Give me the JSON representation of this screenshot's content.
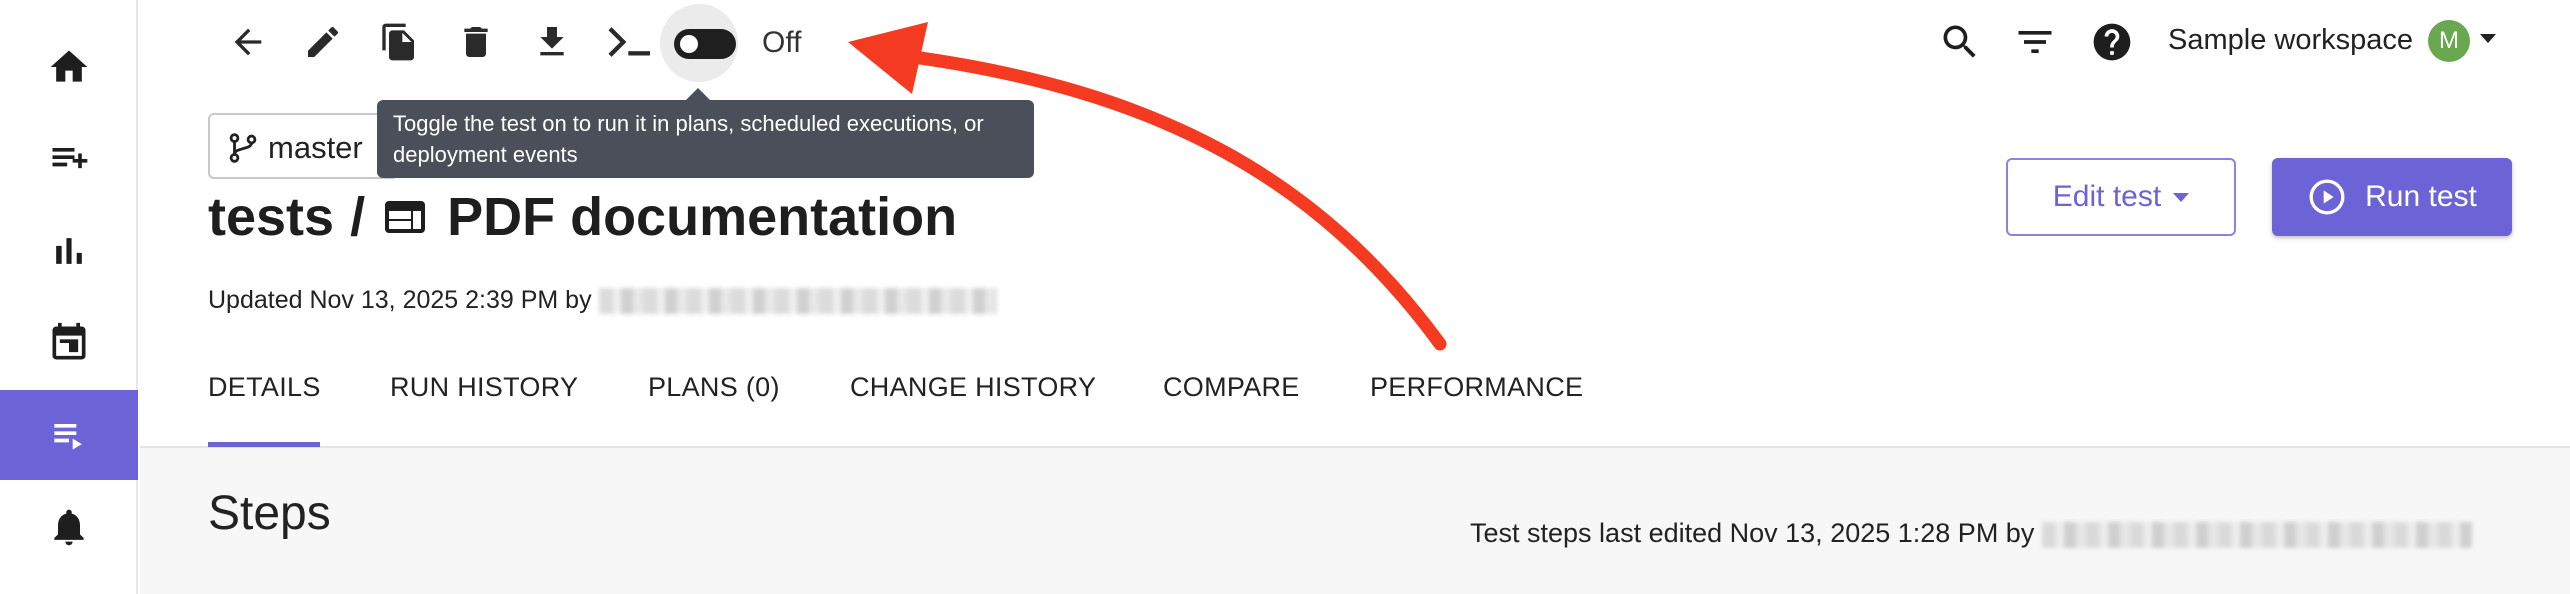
{
  "sidebar": {
    "items": [
      {
        "name": "home-icon"
      },
      {
        "name": "playlist-add-icon"
      },
      {
        "name": "bar-chart-icon"
      },
      {
        "name": "calendar-icon"
      },
      {
        "name": "tests-list-icon",
        "active": true
      },
      {
        "name": "bell-icon"
      }
    ]
  },
  "toolbar": {
    "icons": [
      "back-arrow-icon",
      "edit-pencil-icon",
      "copy-icon",
      "trash-icon",
      "download-icon",
      "terminal-icon"
    ],
    "toggle_label": "Off",
    "tooltip": "Toggle the test on to run it in plans, scheduled executions, or deployment events"
  },
  "header": {
    "icons": [
      "search-icon",
      "filter-icon",
      "help-icon"
    ],
    "workspace_name": "Sample workspace",
    "avatar_initial": "M"
  },
  "branch": {
    "label": "master"
  },
  "title": {
    "folder": "tests",
    "separator": "/",
    "name": "PDF documentation"
  },
  "updated_text": "Updated Nov 13, 2025 2:39 PM by",
  "actions": {
    "edit_label": "Edit test",
    "run_label": "Run test"
  },
  "tabs": [
    {
      "label": "DETAILS",
      "active": true
    },
    {
      "label": "RUN HISTORY"
    },
    {
      "label": "PLANS (0)"
    },
    {
      "label": "CHANGE HISTORY"
    },
    {
      "label": "COMPARE"
    },
    {
      "label": "PERFORMANCE"
    }
  ],
  "steps": {
    "title": "Steps",
    "edited_text": "Test steps last edited Nov 13, 2025 1:28 PM by"
  },
  "colors": {
    "accent": "#6b63d6",
    "annotation_arrow": "#f43b22",
    "tooltip_bg": "#4b4f5a",
    "avatar_bg": "#6aa84f"
  }
}
